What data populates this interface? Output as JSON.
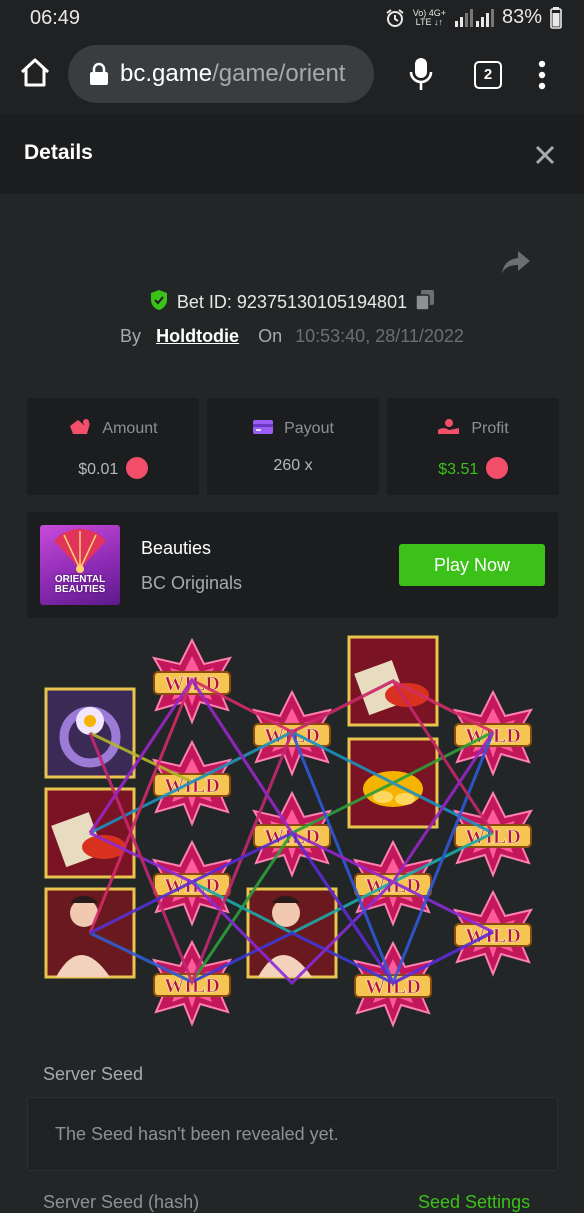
{
  "status_bar": {
    "time": "06:49",
    "network_top": "Vo) 4G+",
    "network_bottom": "LTE ↓↑",
    "battery": "83%"
  },
  "browser": {
    "url_host": "bc.game",
    "url_path": "/game/orient",
    "tab_count": "2"
  },
  "details": {
    "title": "Details"
  },
  "bet": {
    "id_label": "Bet ID: 92375130105194801",
    "by_label": "By",
    "user": "Holdtodie",
    "on_label": "On",
    "timestamp": "10:53:40, 28/11/2022"
  },
  "stats": [
    {
      "label": "Amount",
      "value": "$0.01",
      "icon": "amount-icon"
    },
    {
      "label": "Payout",
      "value": "260 x",
      "icon": "wallet-icon"
    },
    {
      "label": "Profit",
      "value": "$3.51",
      "icon": "profit-icon"
    }
  ],
  "game": {
    "name": "Beauties",
    "provider": "BC Originals",
    "thumb_text": "ORIENTAL BEAUTIES",
    "play_label": "Play Now"
  },
  "board": {
    "symbols": [
      "ring",
      "fish",
      "lady",
      "wild",
      "wild",
      "wild",
      "wild",
      "lady",
      "wild",
      "wild",
      "fish",
      "gold",
      "wild",
      "wild",
      "wild",
      "wild",
      "wild",
      "wild"
    ],
    "wild_text": "WILD"
  },
  "seed": {
    "label": "Server Seed",
    "message": "The Seed hasn't been revealed yet.",
    "next_label": "Server Seed (hash)",
    "settings_label": "Seed Settings"
  },
  "colors": {
    "green": "#3bc117",
    "background": "#232627",
    "panel": "#1b1d1f",
    "tron": "#f34f6b"
  }
}
